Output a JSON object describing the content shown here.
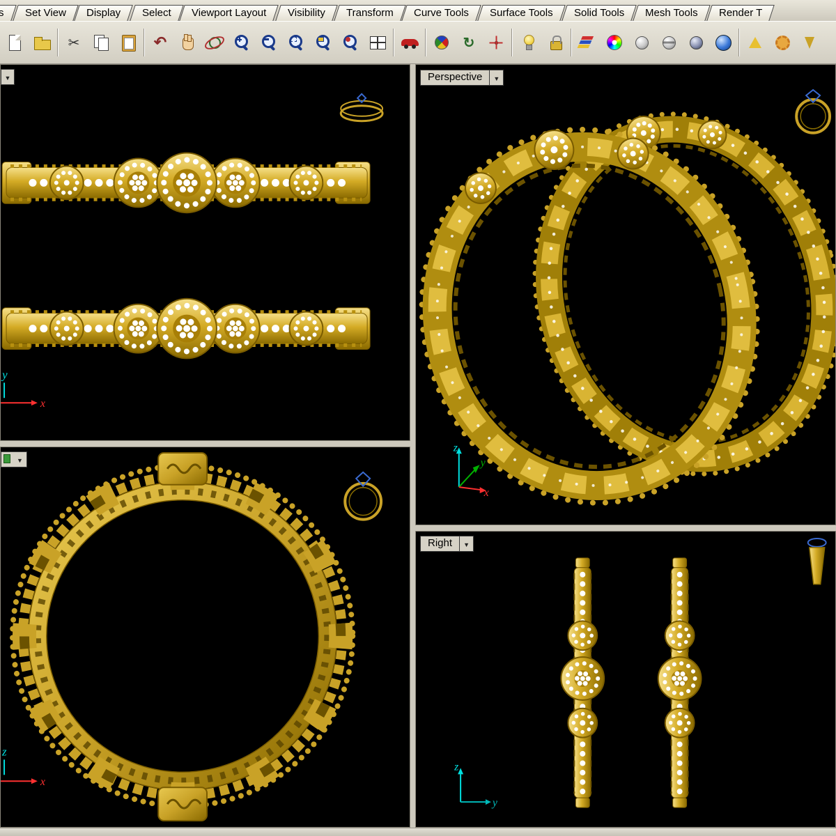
{
  "ui": {
    "dropdown_glyph": "▼",
    "status_bar_text": ""
  },
  "colors": {
    "gold": "#C9A227",
    "gold_dark": "#7A5C00",
    "gold_light": "#F0D469",
    "diamond_white": "#FFFFFF",
    "viewport_background": "#000000",
    "chrome": "#D6D2C6",
    "axis_x_red": "#FF3030",
    "axis_green": "#00B000",
    "axis_cyan": "#00E0E0",
    "active_viewport_green": "#3A9A3A"
  },
  "menu": {
    "tabs": [
      {
        "label": "s"
      },
      {
        "label": "Set View"
      },
      {
        "label": "Display"
      },
      {
        "label": "Select"
      },
      {
        "label": "Viewport Layout"
      },
      {
        "label": "Visibility"
      },
      {
        "label": "Transform"
      },
      {
        "label": "Curve Tools"
      },
      {
        "label": "Surface Tools"
      },
      {
        "label": "Solid Tools"
      },
      {
        "label": "Mesh Tools"
      },
      {
        "label": "Render T"
      }
    ]
  },
  "toolbar": {
    "icons": [
      "new-file",
      "open-file",
      "cut",
      "copy",
      "paste",
      "undo",
      "pan-hand",
      "orbit",
      "zoom-in",
      "zoom-out",
      "zoom-window",
      "zoom-extents",
      "zoom-selected",
      "viewport-layout",
      "car",
      "compass",
      "rotate",
      "move-point",
      "lightbulb",
      "lock",
      "layers",
      "color-wheel",
      "sphere-shaded",
      "sphere-banded",
      "sphere-dark",
      "sphere-blue",
      "prism",
      "gears",
      "cone"
    ]
  },
  "viewports": {
    "front": {
      "label": "",
      "axis_h": "x",
      "axis_v": "y"
    },
    "perspective": {
      "label": "Perspective",
      "axis_x": "x",
      "axis_y": "y",
      "axis_z": "z"
    },
    "top": {
      "label": "",
      "axis_h": "x",
      "axis_v": "z"
    },
    "right": {
      "label": "Right",
      "axis_h": "y",
      "axis_v": "z"
    }
  }
}
